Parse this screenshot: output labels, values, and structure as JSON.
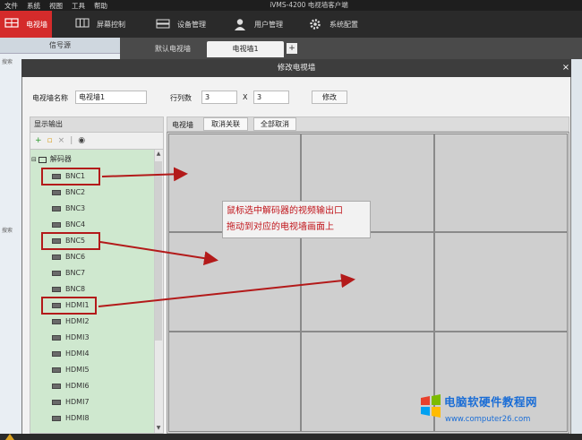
{
  "menu": [
    "文件",
    "系统",
    "视图",
    "工具",
    "帮助"
  ],
  "app_title": "iVMS-4200 电视墙客户端",
  "toolbar": {
    "wall": "电视墙",
    "screen_ctrl": "屏幕控制",
    "device_mgmt": "设备管理",
    "user_mgmt": "用户管理",
    "sys_config": "系统配置"
  },
  "background": {
    "signal_source": "信号源",
    "tabs": [
      "默认电视墙",
      "电视墙1"
    ],
    "add_tab": "+",
    "search1": "搜索",
    "search2": "搜索"
  },
  "dialog": {
    "title": "修改电视墙",
    "close": "×",
    "name_label": "电视墙名称",
    "name_value": "电视墙1",
    "rowcol_label": "行列数",
    "rows": "3",
    "x": "X",
    "cols": "3",
    "modify_btn": "修改",
    "display_output": "显示输出",
    "wall_label": "电视墙",
    "cancel_link_btn": "取消关联",
    "cancel_all_btn": "全部取消",
    "decoder": "解码器",
    "outputs": [
      "BNC1",
      "BNC2",
      "BNC3",
      "BNC4",
      "BNC5",
      "BNC6",
      "BNC7",
      "BNC8",
      "HDMI1",
      "HDMI2",
      "HDMI3",
      "HDMI4",
      "HDMI5",
      "HDMI6",
      "HDMI7",
      "HDMI8"
    ]
  },
  "annotation": {
    "line1": "鼠标选中解码器的视频输出口",
    "line2": "拖动到对应的电视墙画面上"
  },
  "watermark": {
    "title": "电脑软硬件教程网",
    "url": "www.computer26.com"
  },
  "colors": {
    "accent_red": "#d42b2b",
    "annotation_red": "#c0141a",
    "list_green": "#cfe8cf",
    "watermark_blue": "#1a6dd6"
  }
}
